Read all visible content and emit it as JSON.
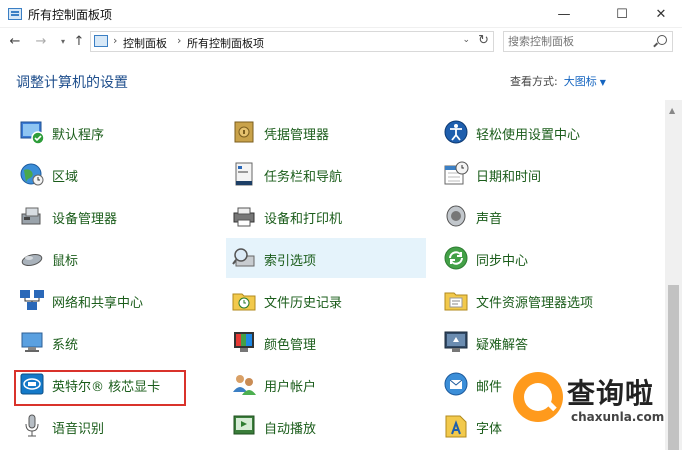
{
  "window": {
    "title": "所有控制面板项",
    "minimize": "—",
    "maximize": "☐",
    "close": "✕"
  },
  "nav": {
    "back": "←",
    "forward": "→",
    "recent": "▾",
    "up": "↑",
    "breadcrumb": [
      "控制面板",
      "所有控制面板项"
    ],
    "separator": "›",
    "dropdown": "⌄",
    "refresh": "↻"
  },
  "search": {
    "placeholder": "搜索控制面板"
  },
  "header": {
    "title": "调整计算机的设置",
    "view_by_label": "查看方式:",
    "view_by_value": "大图标",
    "view_by_caret": "▼"
  },
  "items": {
    "default_programs": "默认程序",
    "credential_manager": "凭据管理器",
    "ease_of_access": "轻松使用设置中心",
    "region": "区域",
    "taskbar_nav": "任务栏和导航",
    "date_time": "日期和时间",
    "device_manager": "设备管理器",
    "devices_printers": "设备和打印机",
    "sound": "声音",
    "mouse": "鼠标",
    "indexing": "索引选项",
    "sync_center": "同步中心",
    "network_sharing": "网络和共享中心",
    "file_history": "文件历史记录",
    "file_explorer_options": "文件资源管理器选项",
    "system": "系统",
    "color_management": "颜色管理",
    "troubleshooting": "疑难解答",
    "intel_graphics": "英特尔® 核芯显卡",
    "user_accounts": "用户帐户",
    "mail": "邮件",
    "speech_recognition": "语音识别",
    "autoplay": "自动播放",
    "fonts": "字体"
  },
  "scrollbar": {
    "up_arrow": "▲"
  },
  "watermark": {
    "text": "查询啦",
    "url": "chaxunla.com"
  }
}
